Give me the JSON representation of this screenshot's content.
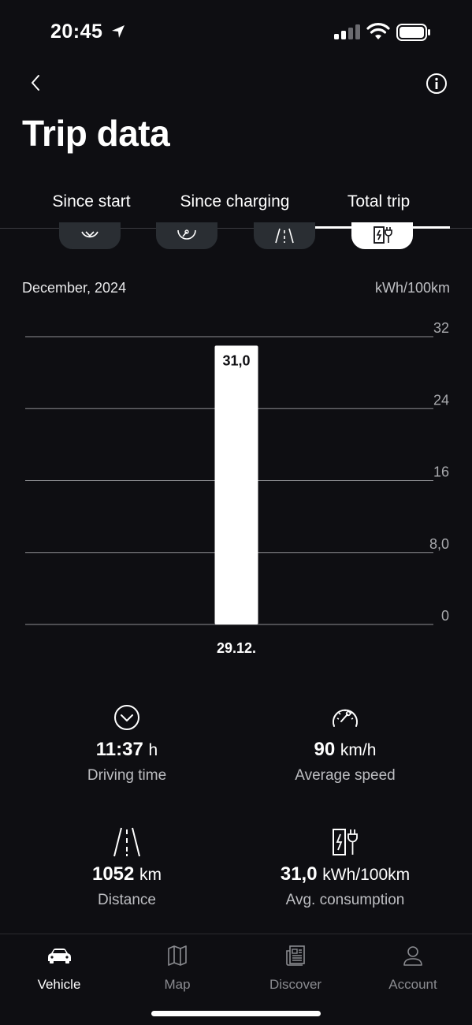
{
  "status_bar": {
    "time": "20:45"
  },
  "header": {
    "title": "Trip data"
  },
  "tabs": [
    {
      "label": "Since start"
    },
    {
      "label": "Since charging"
    },
    {
      "label": "Total trip"
    }
  ],
  "selected_tab": "Total trip",
  "chart_header": {
    "period": "December, 2024",
    "unit": "kWh/100km"
  },
  "chart_data": {
    "type": "bar",
    "categories": [
      "29.12."
    ],
    "values": [
      31.0
    ],
    "value_labels": [
      "31,0"
    ],
    "title": "",
    "xlabel": "",
    "ylabel": "kWh/100km",
    "ylim": [
      0,
      32
    ],
    "y_ticks": [
      0,
      8,
      16,
      24,
      32
    ],
    "y_tick_labels": [
      "0",
      "8,0",
      "16",
      "24",
      "32"
    ],
    "grid": true,
    "bar_color": "#ffffff"
  },
  "stats": {
    "driving_time": {
      "value": "11:37",
      "unit": "h",
      "label": "Driving time"
    },
    "average_speed": {
      "value": "90",
      "unit": "km/h",
      "label": "Average speed"
    },
    "distance": {
      "value": "1052",
      "unit": "km",
      "label": "Distance"
    },
    "avg_consumption": {
      "value": "31,0",
      "unit": "kWh/100km",
      "label": "Avg. consumption"
    }
  },
  "tabbar": [
    {
      "label": "Vehicle",
      "icon": "car-icon"
    },
    {
      "label": "Map",
      "icon": "map-icon"
    },
    {
      "label": "Discover",
      "icon": "news-icon"
    },
    {
      "label": "Account",
      "icon": "person-icon"
    }
  ],
  "colors": {
    "background": "#0e0e12",
    "chip": "#2a2e33",
    "accent": "#ffffff",
    "muted": "#8a8b90"
  }
}
